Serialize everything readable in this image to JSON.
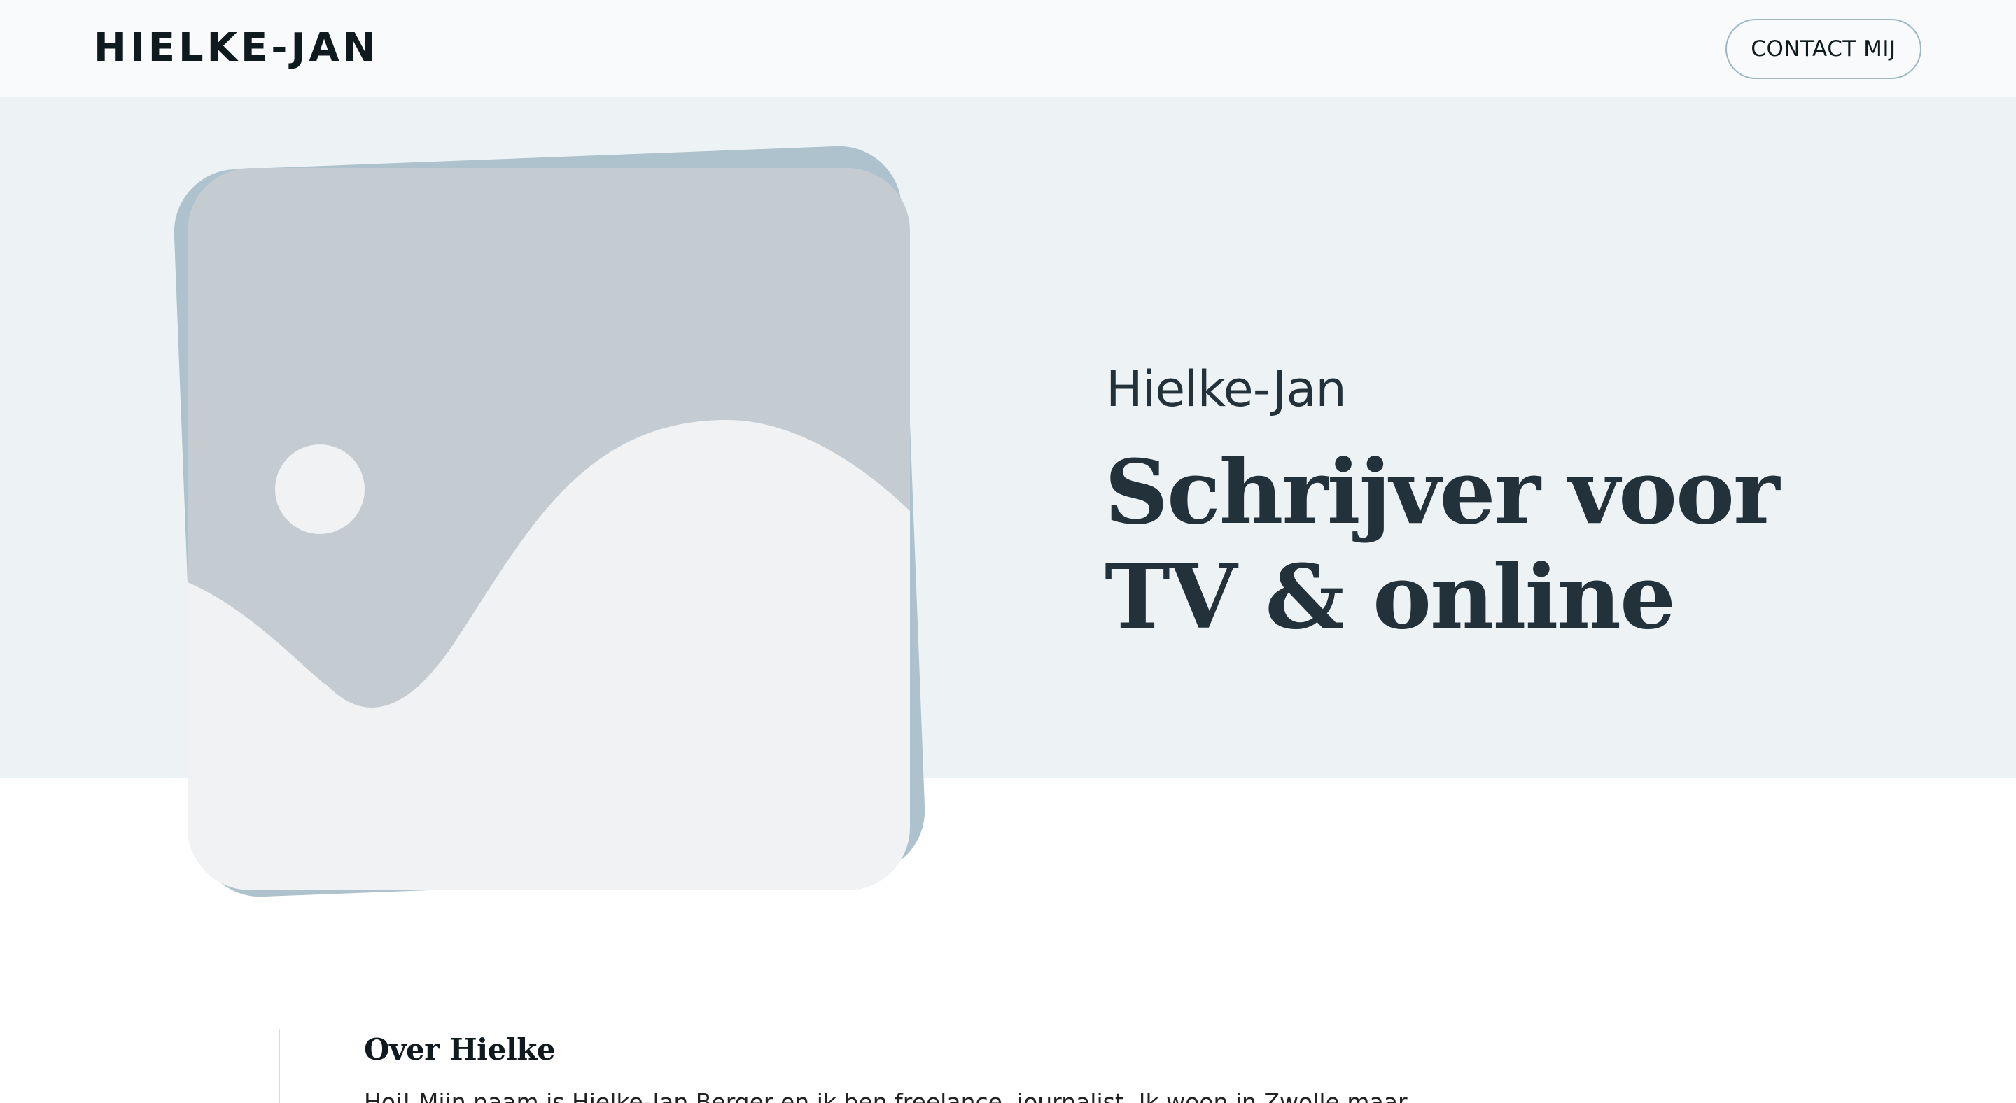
{
  "header": {
    "logo": "HIELKE-JAN",
    "contact_label": "CONTACT MIJ"
  },
  "hero": {
    "name": "Hielke-Jan",
    "title_line1": "Schrijver voor",
    "title_line2": "TV & online",
    "image_icon": "image-placeholder-icon"
  },
  "about": {
    "heading": "Over Hielke",
    "text": "Hoi! Mijn naam is Hielke-Jan Berger en ik ben freelance, journalist. Ik woon in Zwolle maar..."
  },
  "colors": {
    "header_bg": "#f8fafc",
    "hero_bg": "#edf2f4",
    "accent_blue_gray": "#adc2cc",
    "placeholder_gray": "#c4ccd2",
    "placeholder_light": "#f0f2f4",
    "text_dark": "#22313a"
  }
}
